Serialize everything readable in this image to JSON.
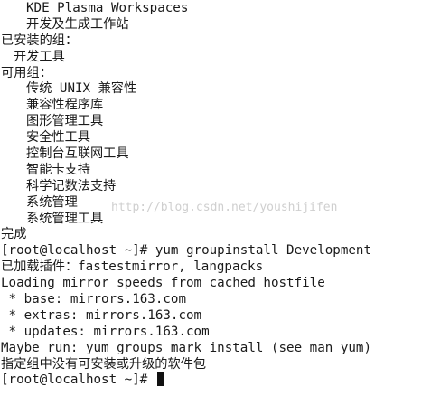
{
  "terminal": {
    "lines": [
      "KDE Plasma Workspaces",
      "开发及生成工作站",
      "已安装的组：",
      "开发工具",
      "可用组：",
      "传统 UNIX 兼容性",
      "兼容性程序库",
      "图形管理工具",
      "安全性工具",
      "控制台互联网工具",
      "智能卡支持",
      "科学记数法支持",
      "系统管理",
      "系统管理工具",
      "完成",
      "[root@localhost ~]# yum groupinstall Development",
      "已加载插件：fastestmirror, langpacks",
      "Loading mirror speeds from cached hostfile",
      " * base: mirrors.163.com",
      " * extras: mirrors.163.com",
      " * updates: mirrors.163.com",
      "Maybe run: yum groups mark install (see man yum)",
      "指定组中没有可安装或升级的软件包",
      "[root@localhost ~]# "
    ]
  },
  "watermark": {
    "text": "http://blog.csdn.net/youshijifen"
  }
}
